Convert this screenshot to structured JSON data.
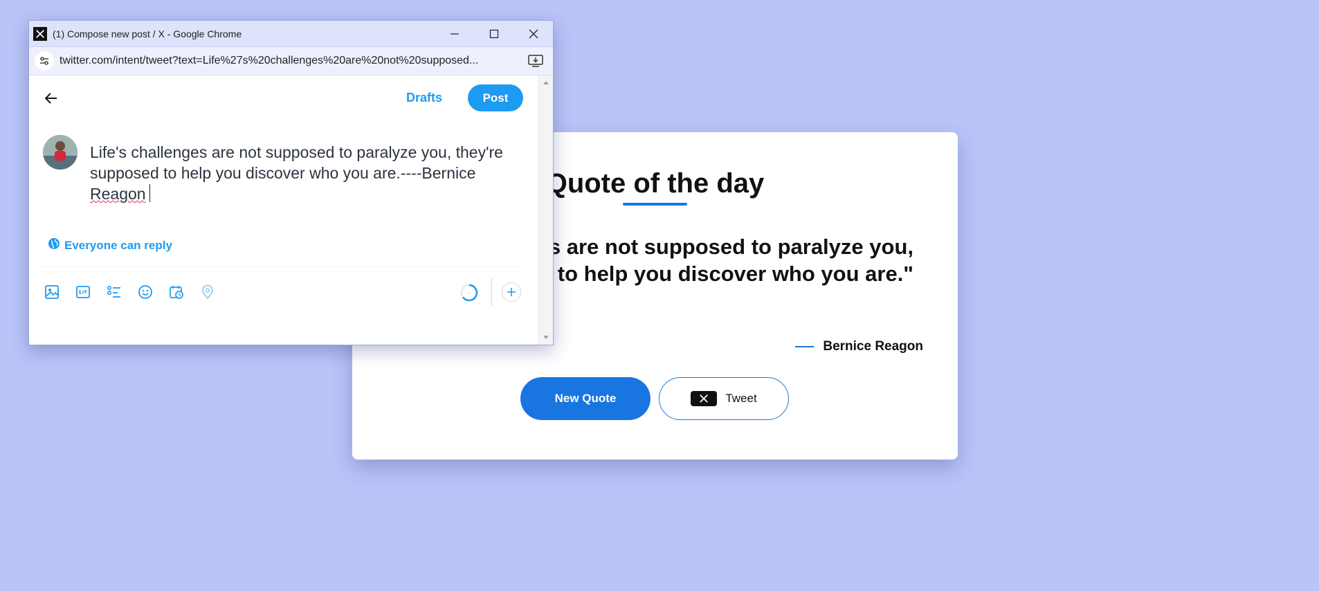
{
  "card": {
    "title": "Quote of the day",
    "quote_line1": "es are not supposed to paralyze you,",
    "quote_line2": "ed to help you discover who you are.\"",
    "author": "Bernice Reagon",
    "new_quote_label": "New Quote",
    "tweet_label": "Tweet"
  },
  "window": {
    "title": "(1) Compose new post / X - Google Chrome",
    "url": "twitter.com/intent/tweet?text=Life%27s%20challenges%20are%20not%20supposed..."
  },
  "compose": {
    "drafts_label": "Drafts",
    "post_label": "Post",
    "text_part1": "Life's challenges are not supposed to paralyze you, they're supposed to help you discover who you are.----Bernice ",
    "text_misspelled": "Reagon",
    "reply_setting": "Everyone can reply"
  },
  "icons": {
    "back": "arrow-left-icon",
    "media": "image-icon",
    "gif": "gif-icon",
    "poll": "poll-icon",
    "emoji": "emoji-icon",
    "schedule": "schedule-icon",
    "location": "location-icon",
    "globe": "globe-icon",
    "add": "plus-icon"
  },
  "colors": {
    "background": "#bac4f8",
    "card_accent": "#1976e0",
    "x_blue": "#1d9bf0"
  }
}
